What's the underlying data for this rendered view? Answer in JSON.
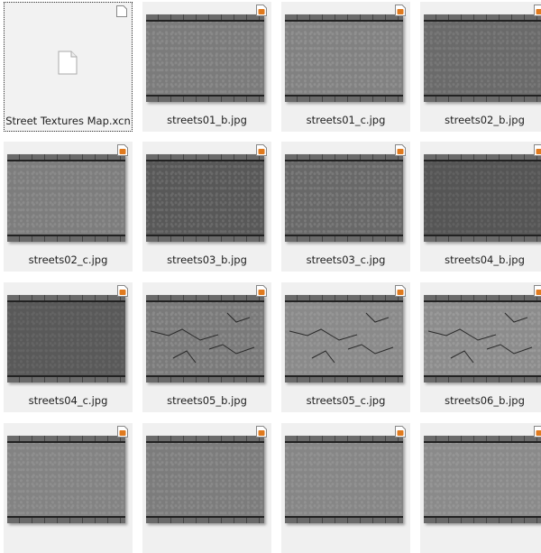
{
  "files": [
    {
      "name": "Street Textures Map.xcn",
      "type": "xcn",
      "selected": true
    },
    {
      "name": "streets01_b.jpg",
      "type": "jpg",
      "tone": "#7b7b7b",
      "speckle": "#8a8a8a"
    },
    {
      "name": "streets01_c.jpg",
      "type": "jpg",
      "tone": "#818181",
      "speckle": "#909090"
    },
    {
      "name": "streets02_b.jpg",
      "type": "jpg",
      "tone": "#6a6a6a",
      "speckle": "#787878"
    },
    {
      "name": "streets02_c.jpg",
      "type": "jpg",
      "tone": "#7d7d7d",
      "speckle": "#8b8b8b"
    },
    {
      "name": "streets03_b.jpg",
      "type": "jpg",
      "tone": "#585858",
      "speckle": "#6a6a6a"
    },
    {
      "name": "streets03_c.jpg",
      "type": "jpg",
      "tone": "#686868",
      "speckle": "#7a7a7a"
    },
    {
      "name": "streets04_b.jpg",
      "type": "jpg",
      "tone": "#555555",
      "speckle": "#626262"
    },
    {
      "name": "streets04_c.jpg",
      "type": "jpg",
      "tone": "#595959",
      "speckle": "#646464"
    },
    {
      "name": "streets05_b.jpg",
      "type": "jpg",
      "tone": "#7a7a7a",
      "speckle": "#8a8a8a",
      "cracks": true
    },
    {
      "name": "streets05_c.jpg",
      "type": "jpg",
      "tone": "#8a8a8a",
      "speckle": "#969696",
      "cracks": true
    },
    {
      "name": "streets06_b.jpg",
      "type": "jpg",
      "tone": "#8c8c8c",
      "speckle": "#9a9a9a",
      "cracks": true
    },
    {
      "name": "",
      "type": "jpg",
      "tone": "#838383",
      "speckle": "#8f8f8f"
    },
    {
      "name": "",
      "type": "jpg",
      "tone": "#7c7c7c",
      "speckle": "#8a8a8a"
    },
    {
      "name": "",
      "type": "jpg",
      "tone": "#868686",
      "speckle": "#929292"
    },
    {
      "name": "",
      "type": "jpg",
      "tone": "#8a8a8a",
      "speckle": "#969696"
    }
  ],
  "colors": {
    "tile_bg": "#f0f0f0",
    "badge_orange": "#e07a1e",
    "selection_border": "#333333"
  },
  "icons": {
    "jpg_badge": "image-file-badge-icon",
    "xcn_badge": "blank-document-badge-icon",
    "xcn_main": "document-icon"
  }
}
